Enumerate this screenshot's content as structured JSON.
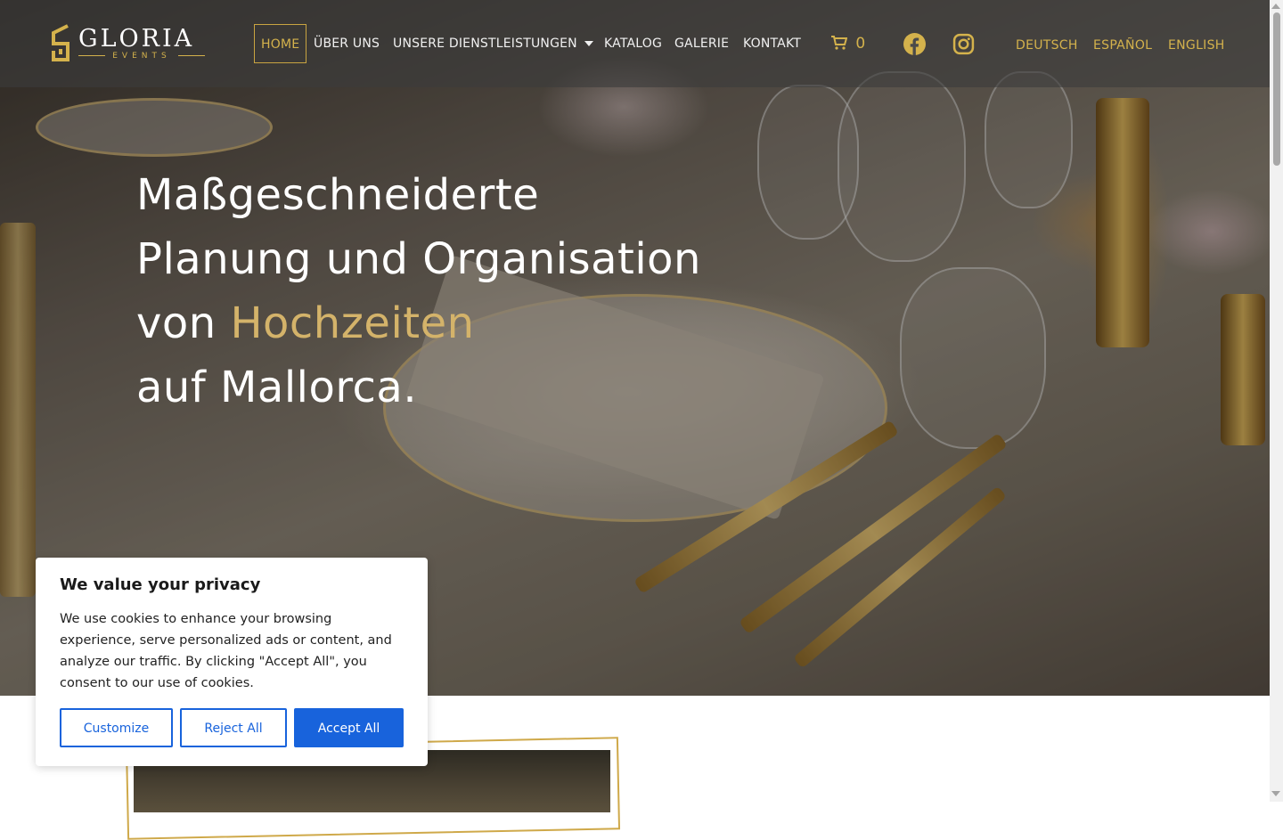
{
  "brand": {
    "name": "GLORIA",
    "subtitle": "EVENTS",
    "gold": "#d4b24c"
  },
  "nav": {
    "items": [
      {
        "label": "HOME",
        "active": true
      },
      {
        "label": "ÜBER UNS"
      },
      {
        "label": "UNSERE DIENSTLEISTUNGEN",
        "has_dropdown": true
      },
      {
        "label": "KATALOG"
      },
      {
        "label": "GALERIE"
      },
      {
        "label": "KONTAKT"
      }
    ],
    "cart_count": "0",
    "social": [
      "facebook-icon",
      "instagram-icon"
    ],
    "languages": [
      "DEUTSCH",
      "ESPAÑOL",
      "ENGLISH"
    ]
  },
  "hero": {
    "line1": "Maßgeschneiderte",
    "line2": "Planung und Organisation",
    "line3_prefix": "von ",
    "line3_highlight": "Hochzeiten",
    "line4": "auf Mallorca."
  },
  "cookie": {
    "title": "We value your privacy",
    "text": "We use cookies to enhance your browsing experience, serve personalized ads or content, and analyze our traffic. By clicking \"Accept All\", you consent to our use of cookies.",
    "customize": "Customize",
    "reject": "Reject All",
    "accept": "Accept All",
    "accent": "#1863dc"
  }
}
